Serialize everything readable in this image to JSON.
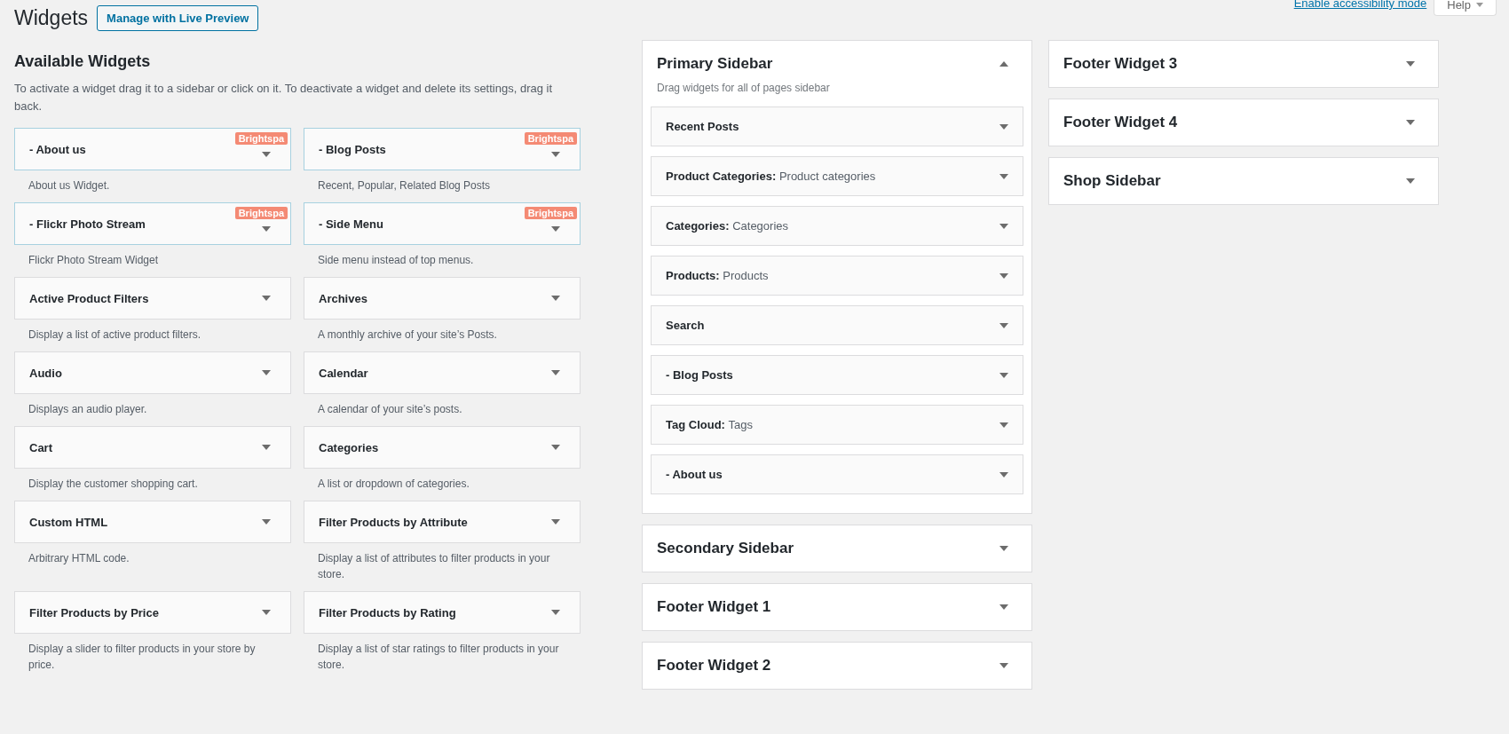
{
  "page_title": "Widgets",
  "live_preview_button": "Manage with Live Preview",
  "top_links": {
    "accessibility_link": "Enable accessibility mode",
    "help_tab": "Help"
  },
  "available": {
    "heading": "Available Widgets",
    "description": "To activate a widget drag it to a sidebar or click on it. To deactivate a widget and delete its settings, drag it back.",
    "widgets": [
      {
        "name": "- About us",
        "badge": "Brightspa",
        "description": "About us Widget."
      },
      {
        "name": "- Blog Posts",
        "badge": "Brightspa",
        "description": "Recent, Popular, Related Blog Posts"
      },
      {
        "name": "- Flickr Photo Stream",
        "badge": "Brightspa",
        "description": "Flickr Photo Stream Widget"
      },
      {
        "name": "- Side Menu",
        "badge": "Brightspa",
        "description": "Side menu instead of top menus."
      },
      {
        "name": "Active Product Filters",
        "description": "Display a list of active product filters."
      },
      {
        "name": "Archives",
        "description": "A monthly archive of your site’s Posts."
      },
      {
        "name": "Audio",
        "description": "Displays an audio player."
      },
      {
        "name": "Calendar",
        "description": "A calendar of your site’s posts."
      },
      {
        "name": "Cart",
        "description": "Display the customer shopping cart."
      },
      {
        "name": "Categories",
        "description": "A list or dropdown of categories."
      },
      {
        "name": "Custom HTML",
        "description": "Arbitrary HTML code."
      },
      {
        "name": "Filter Products by Attribute",
        "description": "Display a list of attributes to filter products in your store."
      },
      {
        "name": "Filter Products by Price",
        "description": "Display a slider to filter products in your store by price."
      },
      {
        "name": "Filter Products by Rating",
        "description": "Display a list of star ratings to filter products in your store."
      }
    ]
  },
  "sidebar_columns": [
    {
      "sidebars": [
        {
          "title": "Primary Sidebar",
          "expanded": true,
          "description": "Drag widgets for all of pages sidebar",
          "widgets": [
            {
              "name": "Recent Posts"
            },
            {
              "name": "Product Categories:",
              "title": "Product categories"
            },
            {
              "name": "Categories:",
              "title": "Categories"
            },
            {
              "name": "Products:",
              "title": "Products"
            },
            {
              "name": "Search"
            },
            {
              "name": "- Blog Posts"
            },
            {
              "name": "Tag Cloud:",
              "title": "Tags"
            },
            {
              "name": "- About us"
            }
          ]
        },
        {
          "title": "Secondary Sidebar",
          "expanded": false
        },
        {
          "title": "Footer Widget 1",
          "expanded": false
        },
        {
          "title": "Footer Widget 2",
          "expanded": false
        }
      ]
    },
    {
      "sidebars": [
        {
          "title": "Footer Widget 3",
          "expanded": false
        },
        {
          "title": "Footer Widget 4",
          "expanded": false
        },
        {
          "title": "Shop Sidebar",
          "expanded": false
        }
      ]
    }
  ]
}
